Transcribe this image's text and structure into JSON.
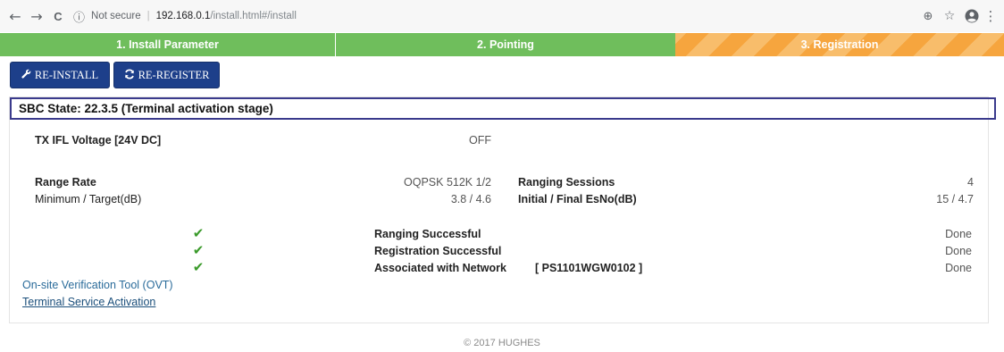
{
  "browser": {
    "back_icon": "←",
    "forward_icon": "→",
    "reload_icon": "C",
    "info_icon": "ⓘ",
    "security_label": "Not secure",
    "host": "192.168.0.1",
    "path": "/install.html#/install",
    "zoom_icon": "⊕",
    "star_icon": "☆",
    "account_icon": "●",
    "menu_icon": "⋮"
  },
  "steps": [
    {
      "label": "1. Install Parameter"
    },
    {
      "label": "2. Pointing"
    },
    {
      "label": "3. Registration"
    }
  ],
  "toolbar": {
    "reinstall_icon": "wrench-icon",
    "reinstall_label": "RE-INSTALL",
    "reregister_icon": "refresh-icon",
    "reregister_label": "RE-REGISTER"
  },
  "state": {
    "label": "SBC State: 22.3.5 (Terminal activation stage)"
  },
  "tx_ifl": {
    "label": "TX IFL Voltage [24V DC]",
    "value": "OFF"
  },
  "range": {
    "rate_label": "Range Rate",
    "rate_value": "OQPSK 512K 1/2",
    "min_target_label": "Minimum / Target(dB)",
    "min_target_value": "3.8 / 4.6",
    "sessions_label": "Ranging Sessions",
    "sessions_value": "4",
    "esno_label": "Initial / Final EsNo(dB)",
    "esno_value": "15 / 4.7"
  },
  "checklist": [
    {
      "label": "Ranging Successful",
      "status": "Done"
    },
    {
      "label": "Registration Successful",
      "status": "Done"
    },
    {
      "label": "Associated with Network",
      "network_id": "[ PS1101WGW0102 ]",
      "status": "Done"
    }
  ],
  "links": {
    "ovt": "On-site Verification Tool (OVT)",
    "activation": "Terminal Service Activation"
  },
  "footer": {
    "copyright": "© 2017 HUGHES"
  },
  "colors": {
    "step_complete": "#6fbe5c",
    "step_active": "#f6a53e",
    "button": "#1d3f8a",
    "check": "#3a9a2a"
  }
}
